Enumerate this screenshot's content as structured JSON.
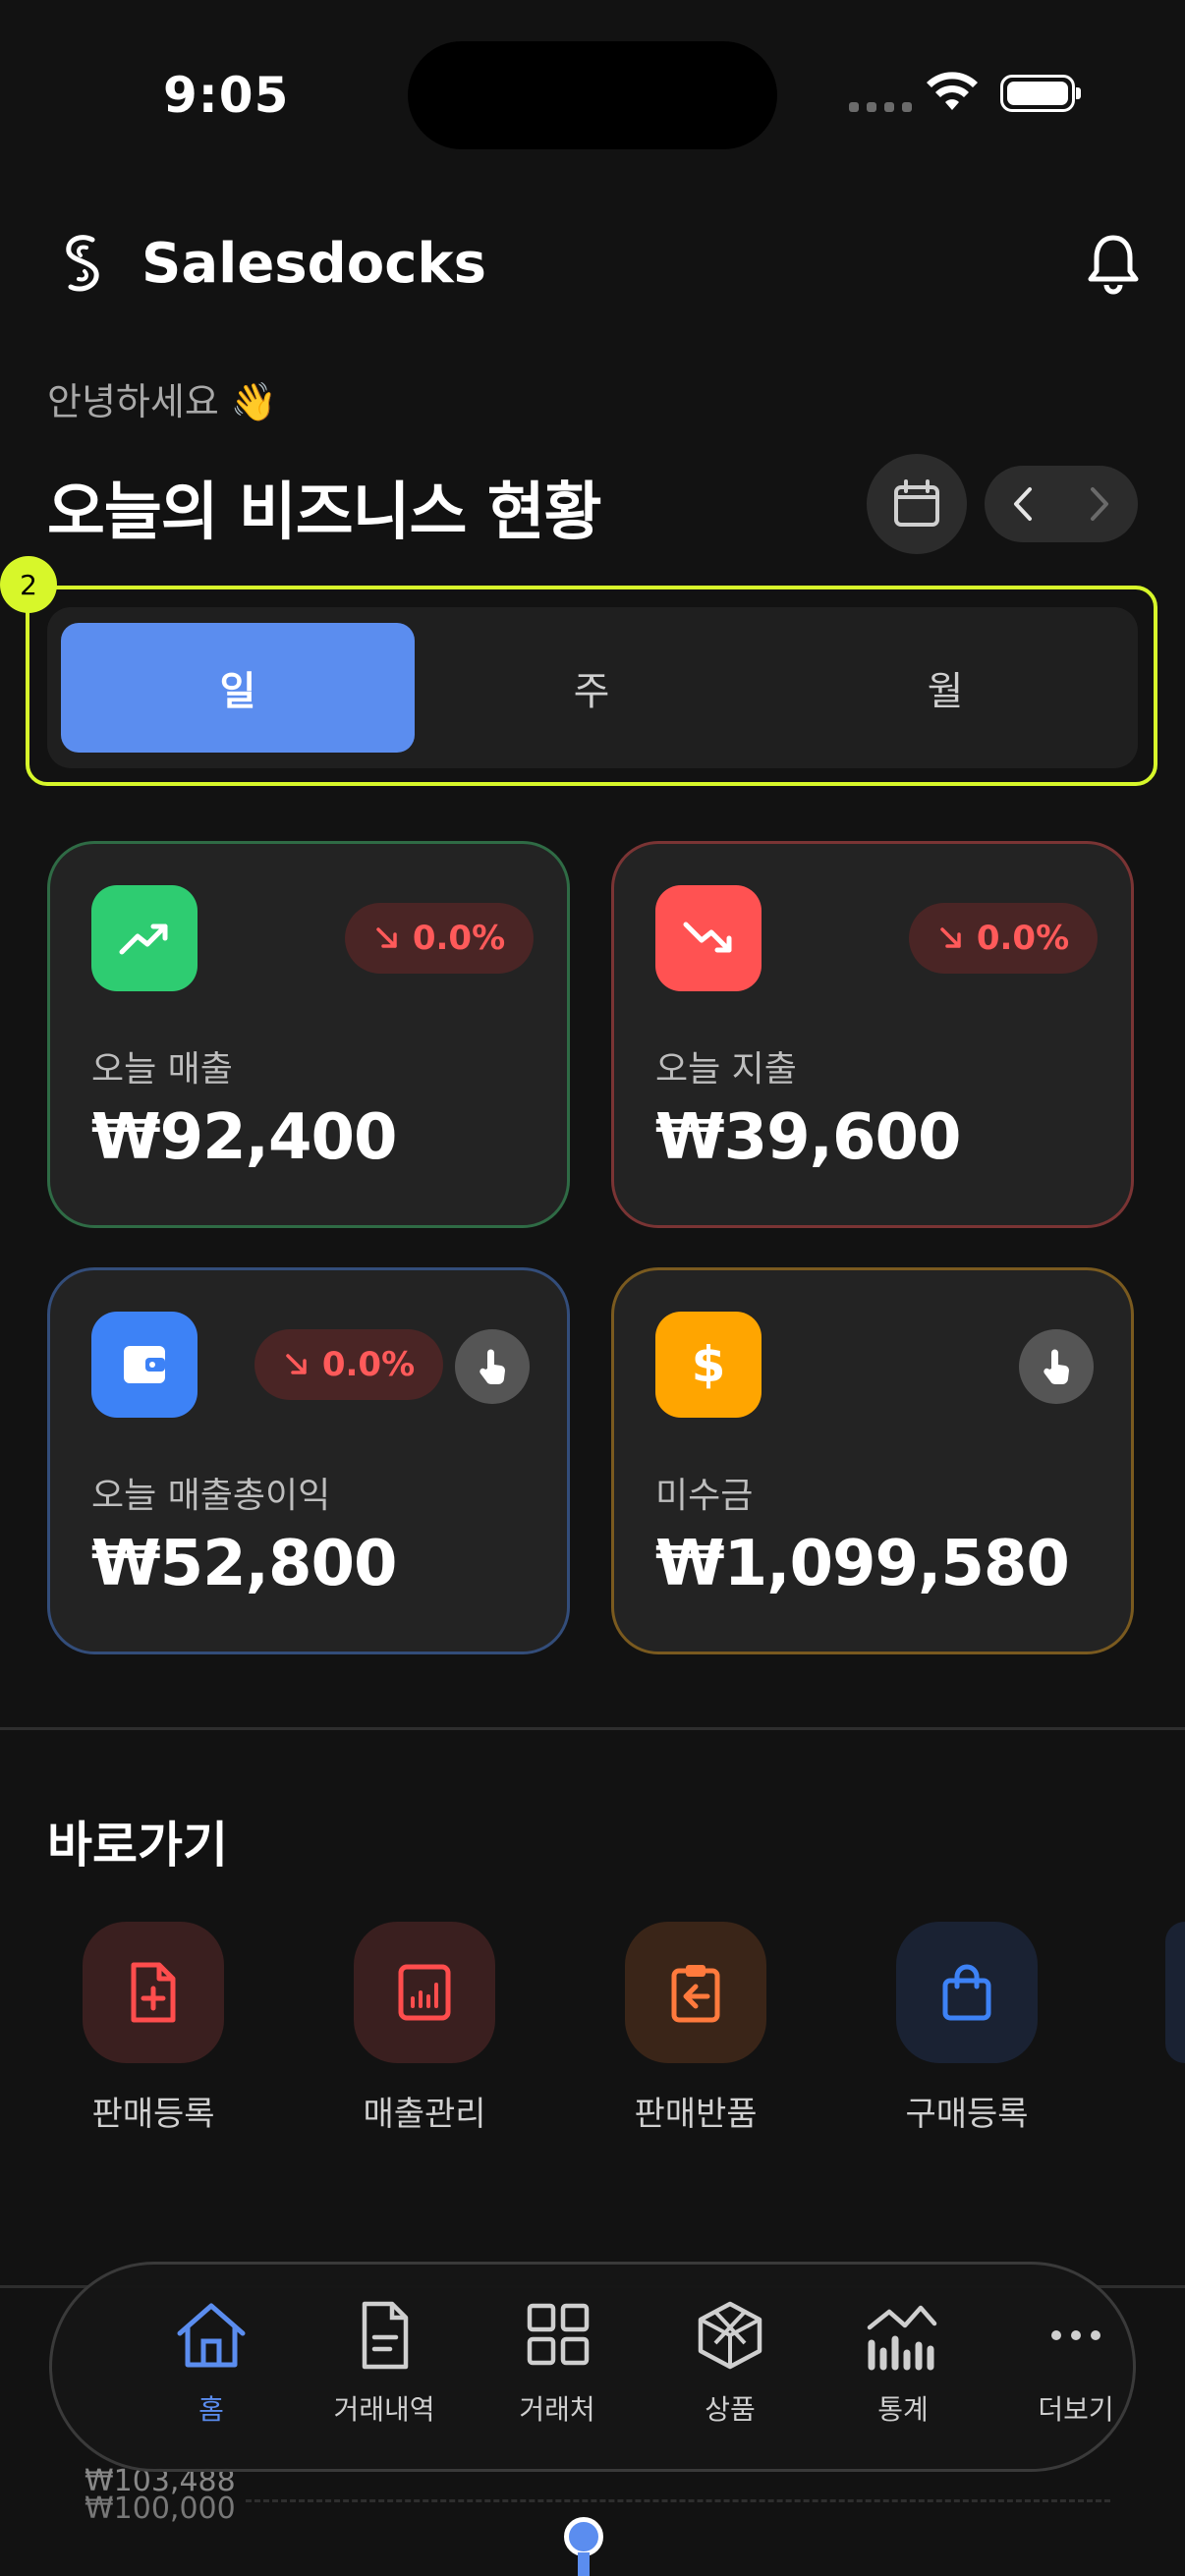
{
  "status_bar": {
    "time": "9:05"
  },
  "header": {
    "app_name": "Salesdocks",
    "greeting": "안녕하세요 👋",
    "title": "오늘의 비즈니스 현황"
  },
  "period_tabs": {
    "badge": "2",
    "items": [
      "일",
      "주",
      "월"
    ],
    "selected": "일"
  },
  "stats": [
    {
      "label": "오늘 매출",
      "amount": "₩92,400",
      "change": "0.0%",
      "accent": "#2ecc71",
      "border": "#2f6b45"
    },
    {
      "label": "오늘 지출",
      "amount": "₩39,600",
      "change": "0.0%",
      "accent": "#ff5252",
      "border": "#7a3434"
    },
    {
      "label": "오늘 매출총이익",
      "amount": "₩52,800",
      "change": "0.0%",
      "accent": "#3d82f6",
      "border": "#334d7a"
    },
    {
      "label": "미수금",
      "amount": "₩1,099,580",
      "accent": "#ffa500",
      "border": "#7a5a1f"
    }
  ],
  "shortcuts": {
    "title": "바로가기",
    "items": [
      {
        "label": "판매등록",
        "icon": "file-plus-icon"
      },
      {
        "label": "매출관리",
        "icon": "report-chart-icon"
      },
      {
        "label": "판매반품",
        "icon": "clipboard-return-icon"
      },
      {
        "label": "구매등록",
        "icon": "shopping-bag-icon"
      }
    ]
  },
  "background_chart": {
    "value_1": "₩103,488",
    "value_2": "₩100,000"
  },
  "bottom_nav": {
    "items": [
      {
        "label": "홈",
        "icon": "home-icon"
      },
      {
        "label": "거래내역",
        "icon": "document-icon"
      },
      {
        "label": "거래처",
        "icon": "grid-icon"
      },
      {
        "label": "상품",
        "icon": "cube-icon"
      },
      {
        "label": "통계",
        "icon": "chart-icon"
      },
      {
        "label": "더보기",
        "icon": "more-icon"
      }
    ],
    "active": "홈"
  }
}
